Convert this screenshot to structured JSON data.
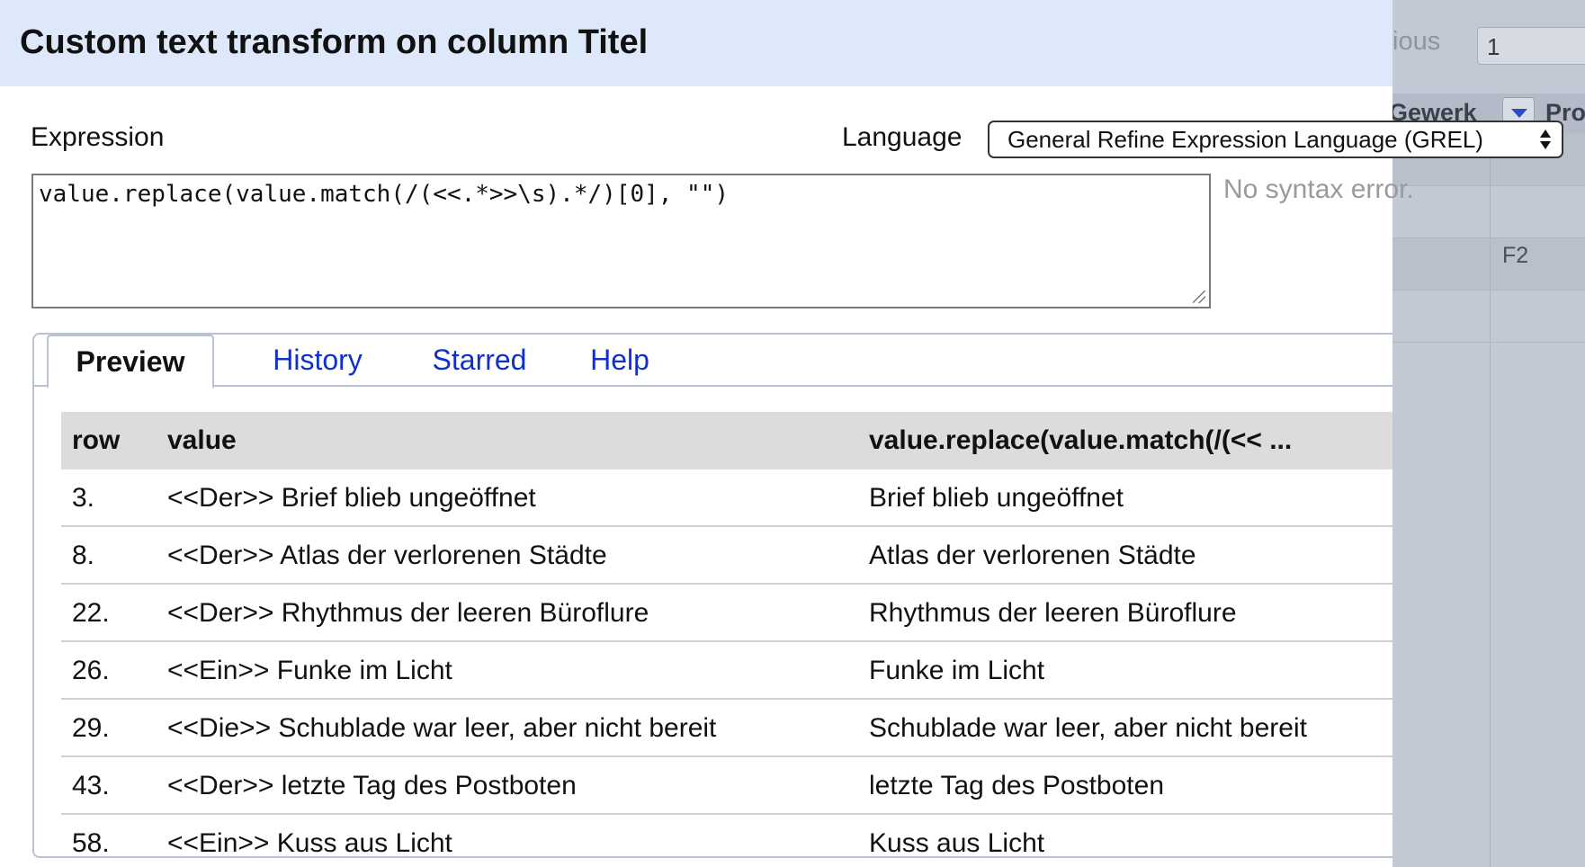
{
  "background_grid": {
    "pager_text": "ious",
    "page_input": "1",
    "column_a": "Gewerk",
    "column_b": "Pro",
    "cell": "F2"
  },
  "dialog": {
    "title": "Custom text transform on column Titel",
    "expression_label": "Expression",
    "language_label": "Language",
    "language_value": "General Refine Expression Language (GREL)",
    "expression": "value.replace(value.match(/(<<.*>>\\s).*/)[0], \"\")",
    "syntax_status": "No syntax error."
  },
  "tabs": [
    {
      "label": "Preview",
      "active": true
    },
    {
      "label": "History",
      "active": false
    },
    {
      "label": "Starred",
      "active": false
    },
    {
      "label": "Help",
      "active": false
    }
  ],
  "preview": {
    "headers": {
      "row": "row",
      "value": "value",
      "result": "value.replace(value.match(/(<< ..."
    },
    "rows": [
      {
        "row": "3.",
        "value": "<<Der>> Brief blieb ungeöffnet",
        "result": "Brief blieb ungeöffnet"
      },
      {
        "row": "8.",
        "value": "<<Der>> Atlas der verlorenen Städte",
        "result": "Atlas der verlorenen Städte"
      },
      {
        "row": "22.",
        "value": "<<Der>> Rhythmus der leeren Büroflure",
        "result": "Rhythmus der leeren Büroflure"
      },
      {
        "row": "26.",
        "value": "<<Ein>> Funke im Licht",
        "result": "Funke im Licht"
      },
      {
        "row": "29.",
        "value": "<<Die>> Schublade war leer, aber nicht bereit",
        "result": "Schublade war leer, aber nicht bereit"
      },
      {
        "row": "43.",
        "value": "<<Der>> letzte Tag des Postboten",
        "result": "letzte Tag des Postboten"
      },
      {
        "row": "58.",
        "value": "<<Ein>> Kuss aus Licht",
        "result": "Kuss aus Licht"
      }
    ]
  },
  "colors": {
    "titlebar": "#dde9fa",
    "tab_link": "#1030cc",
    "table_header": "#dcdcdc"
  }
}
